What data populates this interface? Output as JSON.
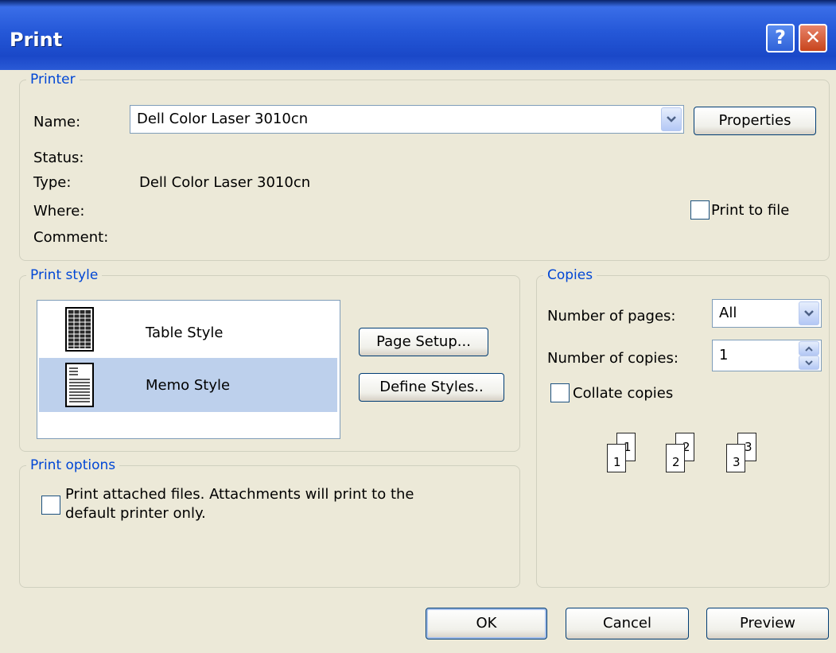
{
  "window": {
    "title": "Print",
    "help_label": "?",
    "close_label": "✕"
  },
  "printer": {
    "legend": "Printer",
    "name_label": "Name:",
    "name_value": "Dell Color Laser 3010cn",
    "properties_label": "Properties",
    "status_label": "Status:",
    "status_value": "",
    "type_label": "Type:",
    "type_value": "Dell Color Laser 3010cn",
    "where_label": "Where:",
    "where_value": "",
    "comment_label": "Comment:",
    "comment_value": "",
    "print_to_file_label": "Print to file",
    "print_to_file_checked": false
  },
  "print_style": {
    "legend": "Print style",
    "styles": [
      {
        "label": "Table Style",
        "icon": "table-style-icon",
        "selected": false
      },
      {
        "label": "Memo Style",
        "icon": "memo-style-icon",
        "selected": true
      }
    ],
    "page_setup_label": "Page Setup...",
    "define_styles_label": "Define Styles.."
  },
  "copies": {
    "legend": "Copies",
    "pages_label": "Number of pages:",
    "pages_value": "All",
    "copies_label": "Number of copies:",
    "copies_value": "1",
    "collate_label": "Collate copies",
    "collate_checked": false,
    "collate_icon": "collate-pages-icon",
    "page_numbers": [
      "1",
      "1",
      "2",
      "2",
      "3",
      "3"
    ]
  },
  "print_options": {
    "legend": "Print options",
    "attached_line1": "Print attached files.  Attachments will print to the",
    "attached_line2": "default printer only.",
    "attached_checked": false
  },
  "buttons": {
    "ok": "OK",
    "cancel": "Cancel",
    "preview": "Preview"
  },
  "colors": {
    "title_bar": "#2558d8",
    "dialog_bg": "#ece9d8",
    "legend": "#0046d5",
    "selection": "#bdd0ec"
  }
}
